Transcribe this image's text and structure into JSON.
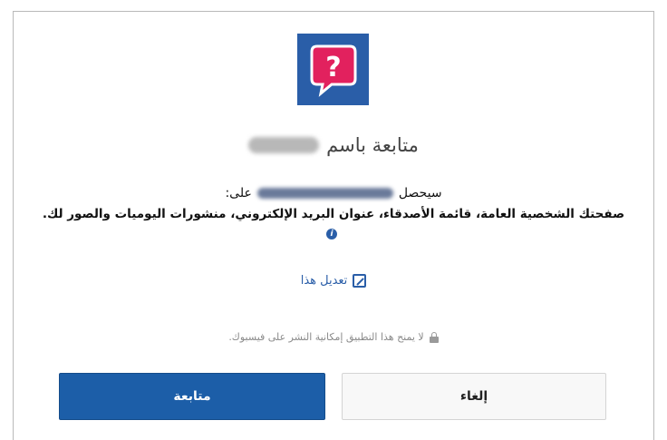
{
  "app": {
    "logo_icon": "speech-bubble-question-icon",
    "logo_glyph": "?",
    "brand_color": "#2a5ea8",
    "accent_pink": "#e2215e"
  },
  "header": {
    "title_prefix": "متابعة باسم"
  },
  "permissions": {
    "line1_prefix": "سيحصل",
    "line1_suffix": "على:",
    "details": "صفحتك الشخصية العامة، قائمة الأصدقاء، عنوان البريد الإلكتروني، منشورات اليوميات والصور لك.",
    "info_icon_glyph": "i"
  },
  "edit": {
    "label": "تعديل هذا",
    "icon": "edit-icon"
  },
  "notice": {
    "text": "لا يمنح هذا التطبيق إمكانية النشر على فيسبوك.",
    "icon": "lock-icon"
  },
  "buttons": {
    "continue_label": "متابعة",
    "cancel_label": "إلغاء"
  }
}
